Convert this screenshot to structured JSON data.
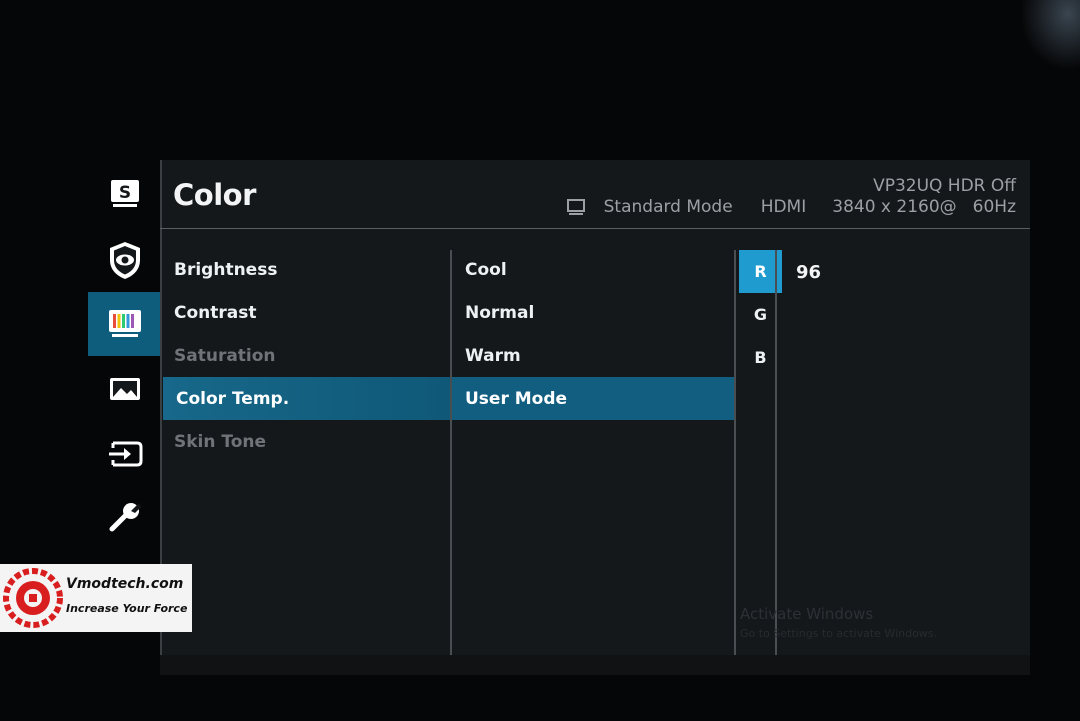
{
  "osd": {
    "title": "Color",
    "model": "VP32UQ HDR Off",
    "status": {
      "mode": "Standard Mode",
      "input": "HDMI",
      "resolution": "3840 x 2160@",
      "refresh": "60Hz"
    }
  },
  "sidebar": {
    "items": [
      {
        "name": "splendid-icon"
      },
      {
        "name": "eye-care-icon"
      },
      {
        "name": "color-icon",
        "active": true
      },
      {
        "name": "image-icon"
      },
      {
        "name": "input-select-icon"
      },
      {
        "name": "system-setup-icon"
      }
    ]
  },
  "color_menu": {
    "items": [
      "Brightness",
      "Contrast",
      "Saturation",
      "Color Temp.",
      "Skin Tone"
    ],
    "disabled": [
      "Saturation",
      "Skin Tone"
    ],
    "selected": "Color Temp."
  },
  "color_temp_menu": {
    "items": [
      "Cool",
      "Normal",
      "Warm",
      "User Mode"
    ],
    "selected": "User Mode"
  },
  "rgb_menu": {
    "items": [
      "R",
      "G",
      "B"
    ],
    "selected": "R",
    "value": "96"
  },
  "watermark": {
    "line1": "Activate Windows",
    "line2": "Go to Settings to activate Windows."
  },
  "logo": {
    "brand": "Vmodtech.com",
    "tagline": "Increase Your Force"
  },
  "colors": {
    "accent": "#125e80",
    "highlight": "#1f9bd0",
    "panel": "#15181b"
  }
}
